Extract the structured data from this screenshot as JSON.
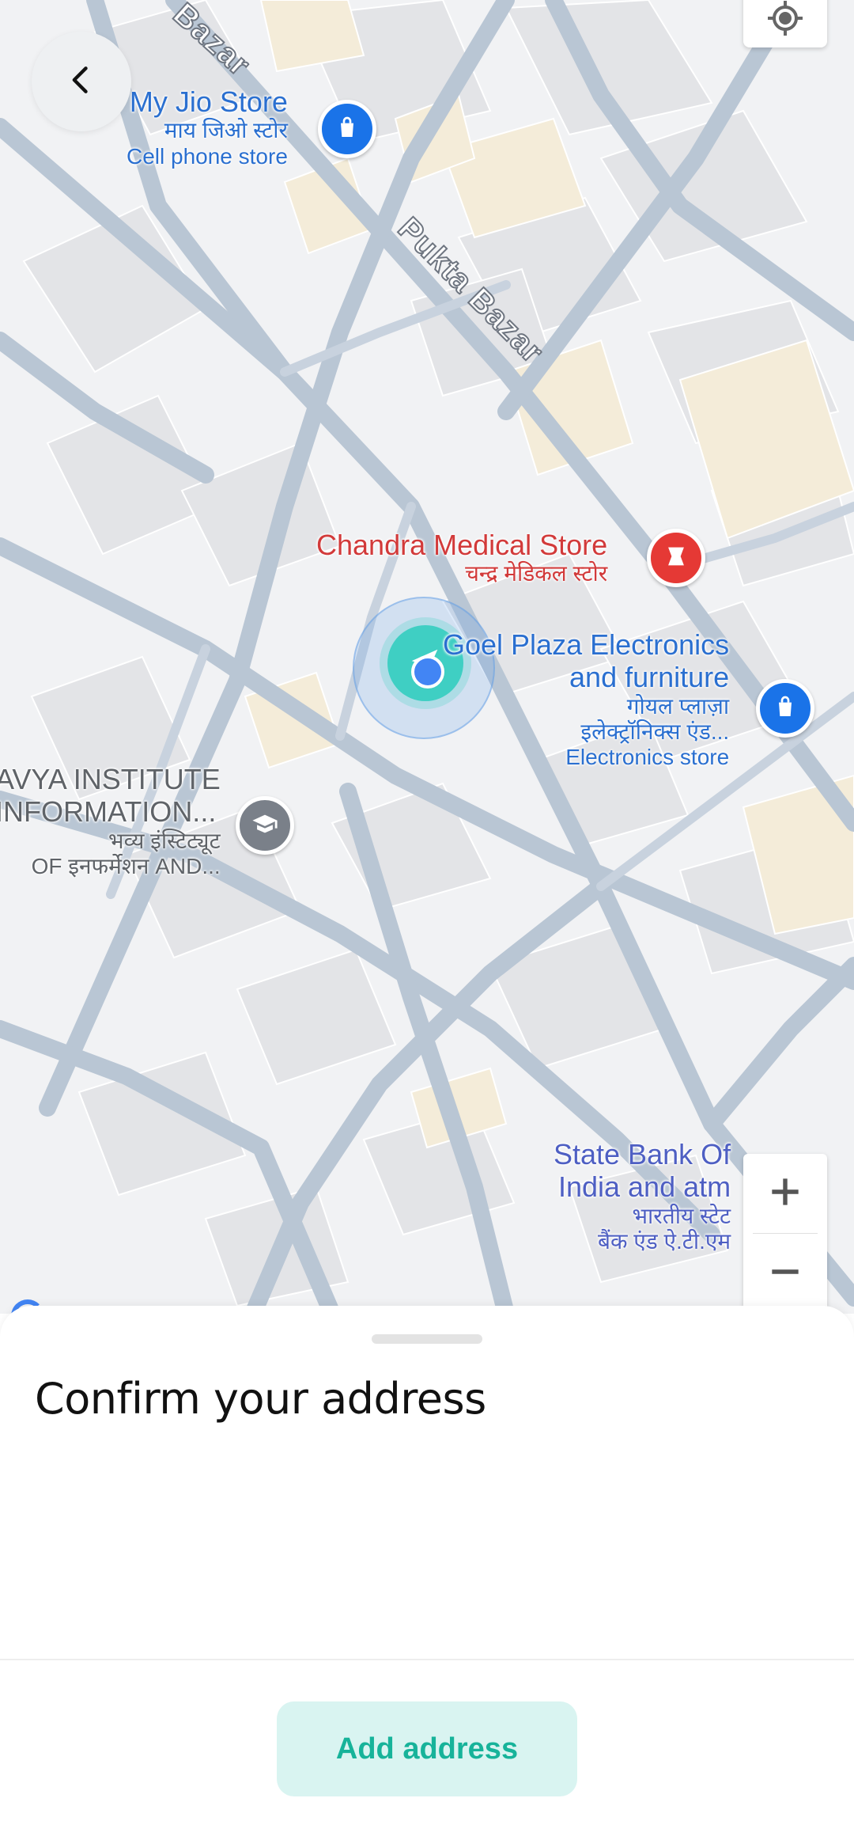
{
  "map": {
    "roads": {
      "pukta_bazar": "Pukta Bazar",
      "bazar_top": "Bazar"
    },
    "pois": {
      "jio": {
        "title": "My Jio Store",
        "subtitle_hi": "माय जिओ स्टोर",
        "category": "Cell phone store",
        "icon": "shopping-bag-icon",
        "color": "#1a73e8"
      },
      "chandra": {
        "title": "Chandra Medical Store",
        "subtitle_hi": "चन्द्र मेडिकल स्टोर",
        "icon": "pharmacy-icon",
        "color": "#e53935"
      },
      "goel": {
        "title_line1": "Goel Plaza Electronics",
        "title_line2": "and furniture",
        "subtitle_hi_1": "गोयल प्लाज़ा",
        "subtitle_hi_2": "इलेक्ट्रॉनिक्स एंड...",
        "category": "Electronics store",
        "icon": "shopping-bag-icon",
        "color": "#1a73e8"
      },
      "institute": {
        "title_line1": "AVYA INSTITUTE",
        "title_line2": "INFORMATION...",
        "subtitle_hi_1": "भव्य इंस्टिट्यूट",
        "subtitle_hi_2": "OF इनफर्मेशन AND...",
        "icon": "school-icon",
        "color": "#7a8089"
      },
      "sbi": {
        "title_line1": "State Bank Of",
        "title_line2": "India and atm",
        "subtitle_hi_1": "भारतीय स्टेट",
        "subtitle_hi_2": "बैंक एंड ऐ.टी.एम",
        "icon": "bank-icon",
        "color": "#5c6bc0"
      }
    },
    "user_location_icon": "navigation-arrow-icon",
    "controls": {
      "zoom_in_icon": "plus-icon",
      "zoom_out_icon": "minus-icon",
      "locate_icon": "my-location-icon",
      "back_icon": "chevron-left-icon"
    }
  },
  "sheet": {
    "title": "Confirm your address",
    "add_button": "Add address",
    "accent_color": "#17b39a"
  }
}
